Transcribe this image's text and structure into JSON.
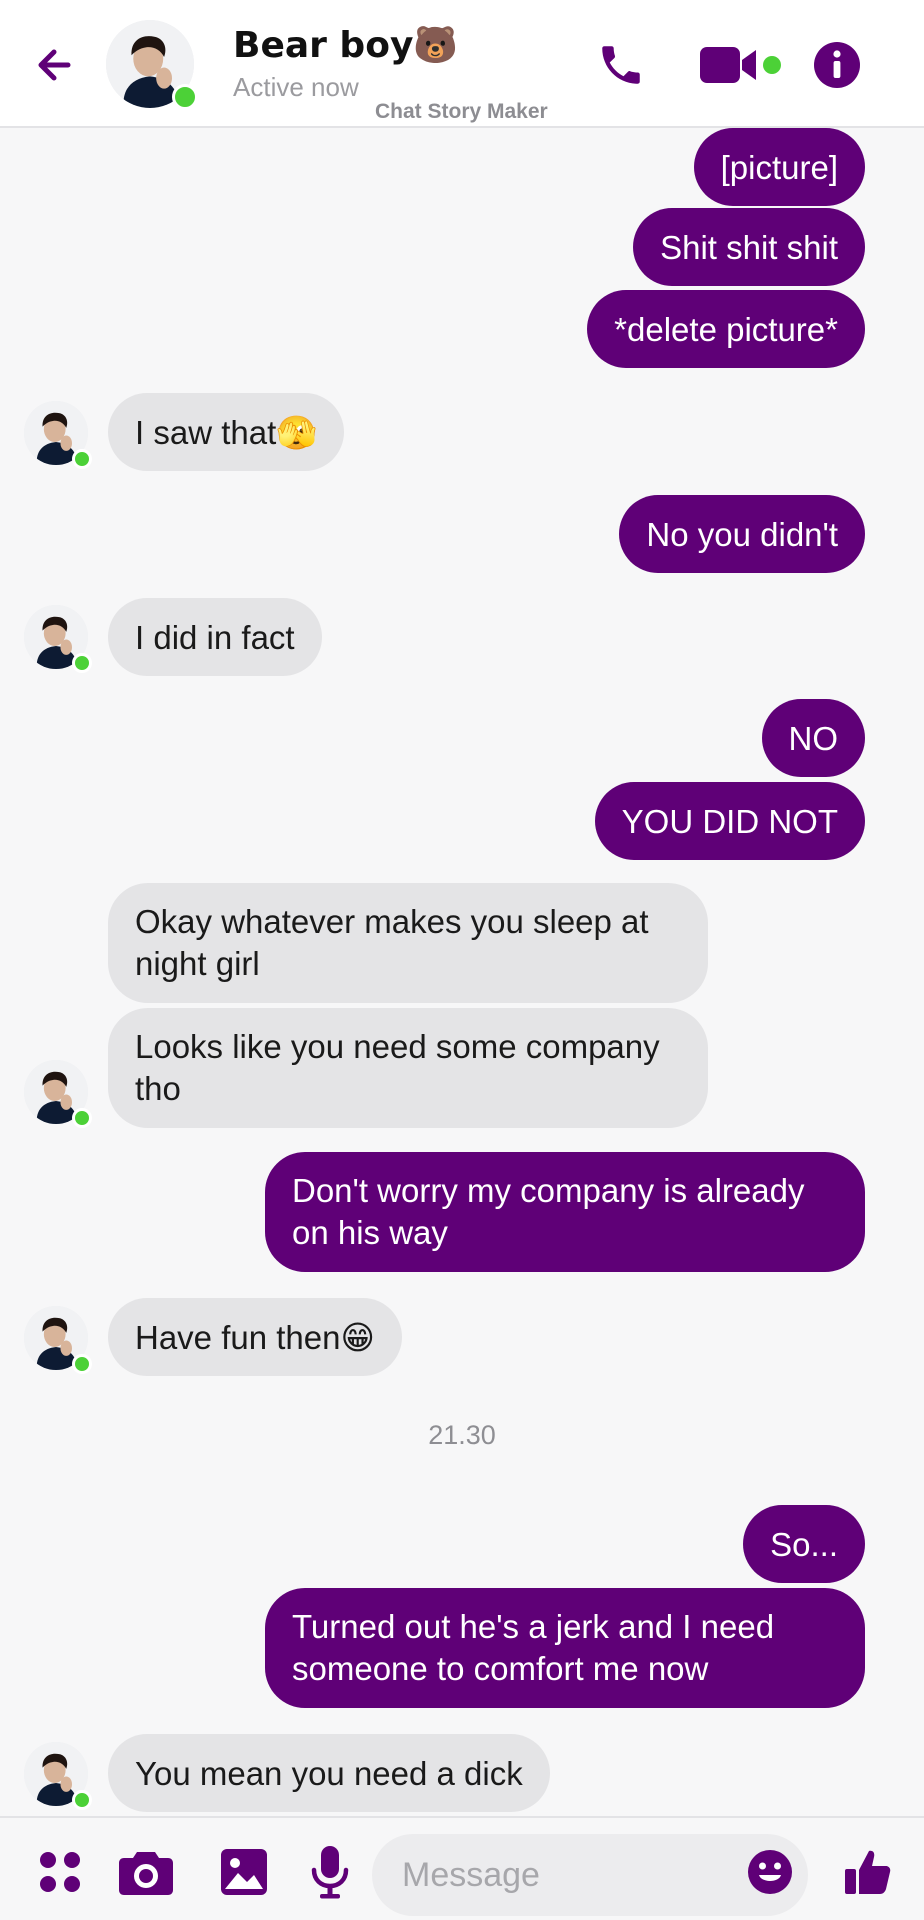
{
  "colors": {
    "accent": "#5f0077",
    "incoming_bubble": "#e4e4e6",
    "online": "#4cd137"
  },
  "header": {
    "contact_name": "Bear boy🐻",
    "status": "Active now",
    "watermark": "Chat Story Maker",
    "icons": [
      "back-arrow-icon",
      "phone-icon",
      "video-camera-icon",
      "info-icon"
    ]
  },
  "messages": [
    {
      "from": "me",
      "text": "[picture]"
    },
    {
      "from": "me",
      "text": "Shit shit shit"
    },
    {
      "from": "me",
      "text": "*delete picture*"
    },
    {
      "from": "them",
      "text": "I saw that",
      "emoji": "🫣"
    },
    {
      "from": "me",
      "text": "No you didn't"
    },
    {
      "from": "them",
      "text": "I did in fact"
    },
    {
      "from": "me",
      "text": "NO"
    },
    {
      "from": "me",
      "text": "YOU DID NOT"
    },
    {
      "from": "them",
      "text": "Okay whatever makes you sleep at night girl"
    },
    {
      "from": "them",
      "text": "Looks like you need some company tho"
    },
    {
      "from": "me",
      "text": "Don't worry my company is already on his way"
    },
    {
      "from": "them",
      "text": "Have fun then",
      "emoji": "😁"
    },
    {
      "from": "me",
      "text": "So..."
    },
    {
      "from": "me",
      "text": "Turned out he's a jerk and I need someone to comfort me now"
    },
    {
      "from": "them",
      "text": "You mean you need a dick"
    }
  ],
  "timestamp": "21.30",
  "composer": {
    "placeholder": "Message",
    "icons": [
      "apps-grid-icon",
      "camera-icon",
      "image-icon",
      "microphone-icon",
      "emoji-icon",
      "thumbs-up-icon"
    ]
  }
}
